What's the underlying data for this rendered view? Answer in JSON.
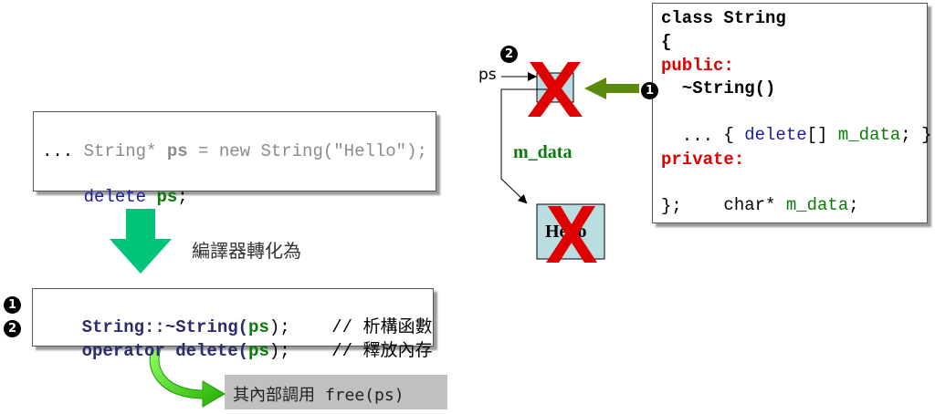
{
  "source_code": {
    "line1_pre": "String* ",
    "line1_var": "ps",
    "line1_post": " = new String(\"Hello\");",
    "line2": "...",
    "line3_kw": "delete",
    "line3_var": "ps",
    "line3_end": ";"
  },
  "transform_label": "編譯器轉化為",
  "compiled_code": {
    "badge1": "1",
    "badge2": "2",
    "line1_a": "String::~String(",
    "line1_var": "ps",
    "line1_b": ");",
    "line1_comment": "// 析構函數",
    "line2_a": "operator delete(",
    "line2_var": "ps",
    "line2_b": ");",
    "line2_comment": "// 釋放內存"
  },
  "free_note": "其內部調用 free(ps)",
  "memory": {
    "ps_label": "ps",
    "m_data_label": "m_data",
    "hello_text": "Hello",
    "badge2": "2",
    "badge1": "1"
  },
  "class_code": {
    "l1": "class String",
    "l2": "{",
    "l3": "public:",
    "l4": "  ~String()",
    "l5_a": "  { ",
    "l5_kw": "delete",
    "l5_b": "[] ",
    "l5_var": "m_data",
    "l5_c": "; }",
    "l6": "  ...",
    "l7": "private:",
    "l8_a": "  char* ",
    "l8_var": "m_data",
    "l8_b": ";",
    "l9": "};"
  },
  "colors": {
    "keyword": "#1a1aa6",
    "variable": "#0a7a0a",
    "access": "#e00000",
    "cross": "#e00000",
    "arrow_down": "#00c47a",
    "arrow_curve": "#22cc00",
    "arrow_olive": "#5a8a10",
    "cell": "#b9dde0"
  }
}
